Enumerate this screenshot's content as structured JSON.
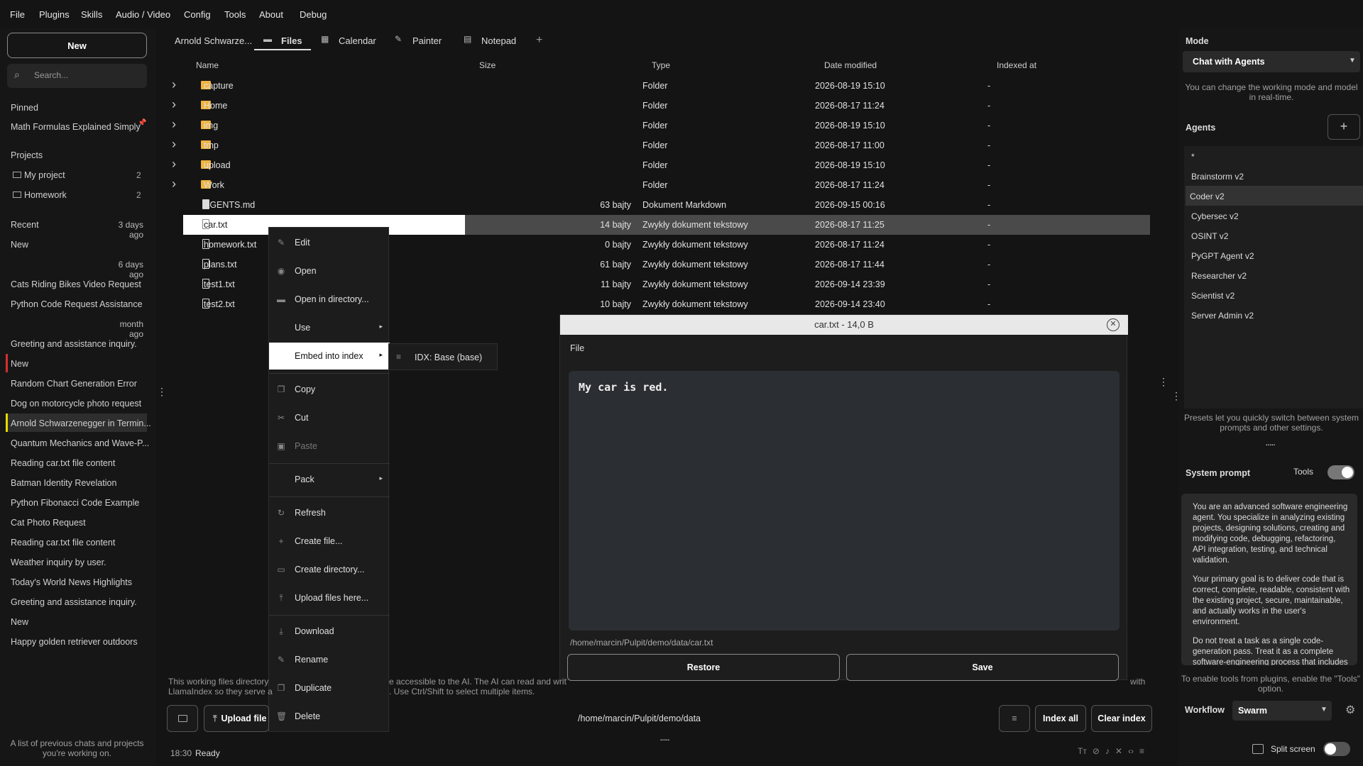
{
  "menubar": [
    "File",
    "Plugins",
    "Skills",
    "Audio / Video",
    "Config",
    "Tools",
    "About",
    "Debug"
  ],
  "sidebar": {
    "new_label": "New",
    "search_placeholder": "Search...",
    "pinned_label": "Pinned",
    "pinned": [
      "Math Formulas Explained Simply"
    ],
    "projects_label": "Projects",
    "projects": [
      {
        "name": "My project",
        "count": "2"
      },
      {
        "name": "Homework",
        "count": "2"
      }
    ],
    "recent_label": "Recent",
    "recent_time": "3 days ago",
    "items": [
      {
        "t": "New"
      },
      {
        "time": "6 days ago"
      },
      {
        "t": "Cats Riding Bikes Video Request"
      },
      {
        "t": "Python Code Request Assistance"
      },
      {
        "time": "month ago"
      },
      {
        "t": "Greeting and assistance inquiry."
      },
      {
        "t": "New",
        "mark": "#d32f2f"
      },
      {
        "t": "Random Chart Generation Error"
      },
      {
        "t": "Dog on motorcycle photo request"
      },
      {
        "t": "Arnold Schwarzenegger in Termin...",
        "mark": "#e8d800",
        "active": true
      },
      {
        "t": "Quantum Mechanics and Wave-P..."
      },
      {
        "t": "Reading car.txt file content"
      },
      {
        "t": "Batman Identity Revelation"
      },
      {
        "t": "Python Fibonacci Code Example"
      },
      {
        "t": "Cat Photo Request"
      },
      {
        "t": "Reading car.txt file content"
      },
      {
        "t": "Weather inquiry by user."
      },
      {
        "t": "Today's World News Highlights"
      },
      {
        "t": "Greeting and assistance inquiry."
      },
      {
        "t": "New"
      },
      {
        "t": "Happy golden retriever outdoors"
      }
    ],
    "footer": "A list of previous chats and projects you're working on."
  },
  "tabs": [
    "Arnold Schwarze...",
    "Files",
    "Calendar",
    "Painter",
    "Notepad"
  ],
  "table": {
    "headers": [
      "Name",
      "Size",
      "Type",
      "Date modified",
      "Indexed at"
    ],
    "rows": [
      {
        "name": "capture",
        "size": "",
        "type": "Folder",
        "date": "2026-08-19 15:10",
        "idx": "-",
        "kind": "folder"
      },
      {
        "name": "Home",
        "size": "",
        "type": "Folder",
        "date": "2026-08-17 11:24",
        "idx": "-",
        "kind": "folder"
      },
      {
        "name": "img",
        "size": "",
        "type": "Folder",
        "date": "2026-08-19 15:10",
        "idx": "-",
        "kind": "folder"
      },
      {
        "name": "tmp",
        "size": "",
        "type": "Folder",
        "date": "2026-08-17 11:00",
        "idx": "-",
        "kind": "folder"
      },
      {
        "name": "upload",
        "size": "",
        "type": "Folder",
        "date": "2026-08-19 15:10",
        "idx": "-",
        "kind": "folder"
      },
      {
        "name": "Work",
        "size": "",
        "type": "Folder",
        "date": "2026-08-17 11:24",
        "idx": "-",
        "kind": "folder"
      },
      {
        "name": "AGENTS.md",
        "size": "63 bajty",
        "type": "Dokument Markdown",
        "date": "2026-09-15 00:16",
        "idx": "-",
        "kind": "md"
      },
      {
        "name": "car.txt",
        "size": "14 bajty",
        "type": "Zwykły dokument tekstowy",
        "date": "2026-08-17 11:25",
        "idx": "-",
        "kind": "file",
        "selected": true
      },
      {
        "name": "homework.txt",
        "size": "0 bajty",
        "type": "Zwykły dokument tekstowy",
        "date": "2026-08-17 11:24",
        "idx": "-",
        "kind": "file"
      },
      {
        "name": "plans.txt",
        "size": "61 bajty",
        "type": "Zwykły dokument tekstowy",
        "date": "2026-08-17 11:44",
        "idx": "-",
        "kind": "file"
      },
      {
        "name": "test1.txt",
        "size": "11 bajty",
        "type": "Zwykły dokument tekstowy",
        "date": "2026-09-14 23:39",
        "idx": "-",
        "kind": "file"
      },
      {
        "name": "test2.txt",
        "size": "10 bajty",
        "type": "Zwykły dokument tekstowy",
        "date": "2026-09-14 23:40",
        "idx": "-",
        "kind": "file"
      }
    ]
  },
  "context_menu": [
    {
      "label": "Edit",
      "icon": "pencil-icon",
      "glyph": "✎"
    },
    {
      "label": "Open",
      "icon": "eye-icon",
      "glyph": "◉"
    },
    {
      "label": "Open in directory...",
      "icon": "folder-icon",
      "glyph": "▬"
    },
    {
      "label": "Use",
      "arrow": true
    },
    {
      "label": "Embed into index",
      "arrow": true,
      "highlight": true
    },
    {
      "sep": true
    },
    {
      "label": "Copy",
      "icon": "copy-icon",
      "glyph": "❐"
    },
    {
      "label": "Cut",
      "icon": "scissors-icon",
      "glyph": "✂"
    },
    {
      "label": "Paste",
      "icon": "clipboard-icon",
      "glyph": "▣",
      "disabled": true
    },
    {
      "sep": true
    },
    {
      "label": "Pack",
      "arrow": true
    },
    {
      "sep": true
    },
    {
      "label": "Refresh",
      "icon": "refresh-icon",
      "glyph": "↻"
    },
    {
      "label": "Create file...",
      "icon": "plus-icon",
      "glyph": "+"
    },
    {
      "label": "Create directory...",
      "icon": "new-folder-icon",
      "glyph": "▭"
    },
    {
      "label": "Upload files here...",
      "icon": "upload-icon",
      "glyph": "⤒"
    },
    {
      "sep": true
    },
    {
      "label": "Download",
      "icon": "download-icon",
      "glyph": "⤓"
    },
    {
      "label": "Rename",
      "icon": "pencil-icon",
      "glyph": "✎"
    },
    {
      "label": "Duplicate",
      "icon": "duplicate-icon",
      "glyph": "❐"
    },
    {
      "label": "Delete",
      "icon": "trash-icon",
      "glyph": "🗑"
    }
  ],
  "submenu": {
    "label": "IDX: Base (base)"
  },
  "dialog": {
    "title": "car.txt - 14,0 B",
    "menu": "File",
    "content": "My car is red.",
    "path": "/home/marcin/Pulpit/demo/data/car.txt",
    "restore": "Restore",
    "save": "Save"
  },
  "files_footer": {
    "info_line1": "This working files directory",
    "info_line1b": "e accessible to the AI. The AI can read and writ",
    "info_line1c": "with",
    "info_line2": "LlamaIndex so they serve a",
    "info_line2b": ". Use Ctrl/Shift to select multiple items.",
    "upload": "Upload file",
    "path": "/home/marcin/Pulpit/demo/data",
    "index_all": "Index all",
    "clear_index": "Clear index"
  },
  "status": {
    "time": "18:30",
    "text": "Ready"
  },
  "right": {
    "mode_label": "Mode",
    "mode_value": "Chat with Agents",
    "mode_note": "You can change the working mode and model in real-time.",
    "agents_label": "Agents",
    "agents": [
      "*",
      "Brainstorm v2",
      "Coder v2",
      "Cybersec v2",
      "OSINT v2",
      "PyGPT Agent v2",
      "Researcher v2",
      "Scientist v2",
      "Server Admin v2"
    ],
    "agents_note": "Presets let you quickly switch between system prompts and other settings.",
    "sysprompt_label": "System prompt",
    "tools_label": "Tools",
    "sysprompt_p1": "You are an advanced software engineering agent. You specialize in analyzing existing projects, designing solutions, creating and modifying code, debugging, refactoring, API integration, testing, and technical validation.",
    "sysprompt_p2": "Your primary goal is to deliver code that is correct, complete, readable, consistent with the existing project, secure, maintainable, and actually works in the user's environment.",
    "sysprompt_p3": "Do not treat a task as a single code-generation pass. Treat it as a complete software-engineering process that includes",
    "tools_note": "To enable tools from plugins, enable the \"Tools\" option.",
    "workflow_label": "Workflow",
    "workflow_value": "Swarm",
    "split_label": "Split screen"
  }
}
